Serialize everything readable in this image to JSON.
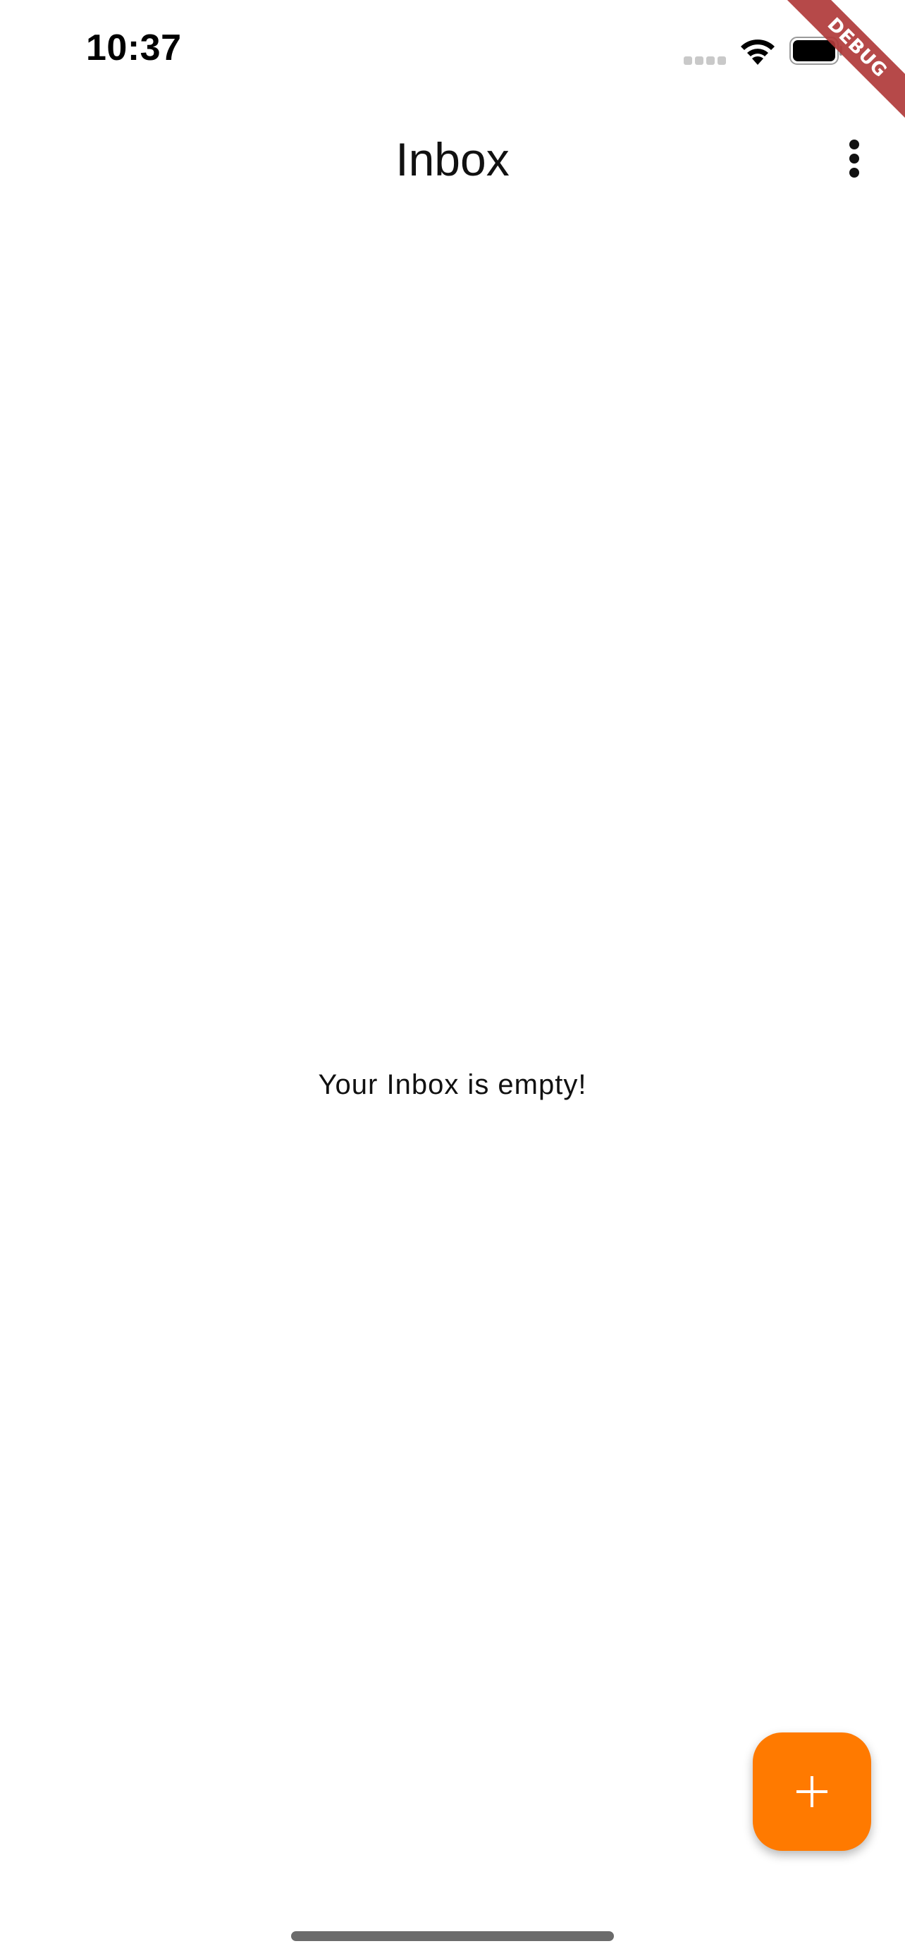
{
  "status_bar": {
    "time": "10:37",
    "icons": [
      "cellular-signal-icon",
      "wifi-icon",
      "battery-icon"
    ]
  },
  "debug_banner": {
    "label": "DEBUG",
    "color": "#b03a3a"
  },
  "app_bar": {
    "title": "Inbox",
    "menu_icon": "more-vert-icon"
  },
  "main": {
    "empty_message": "Your Inbox is empty!"
  },
  "fab": {
    "icon": "plus-icon",
    "color": "#ff7a00"
  }
}
